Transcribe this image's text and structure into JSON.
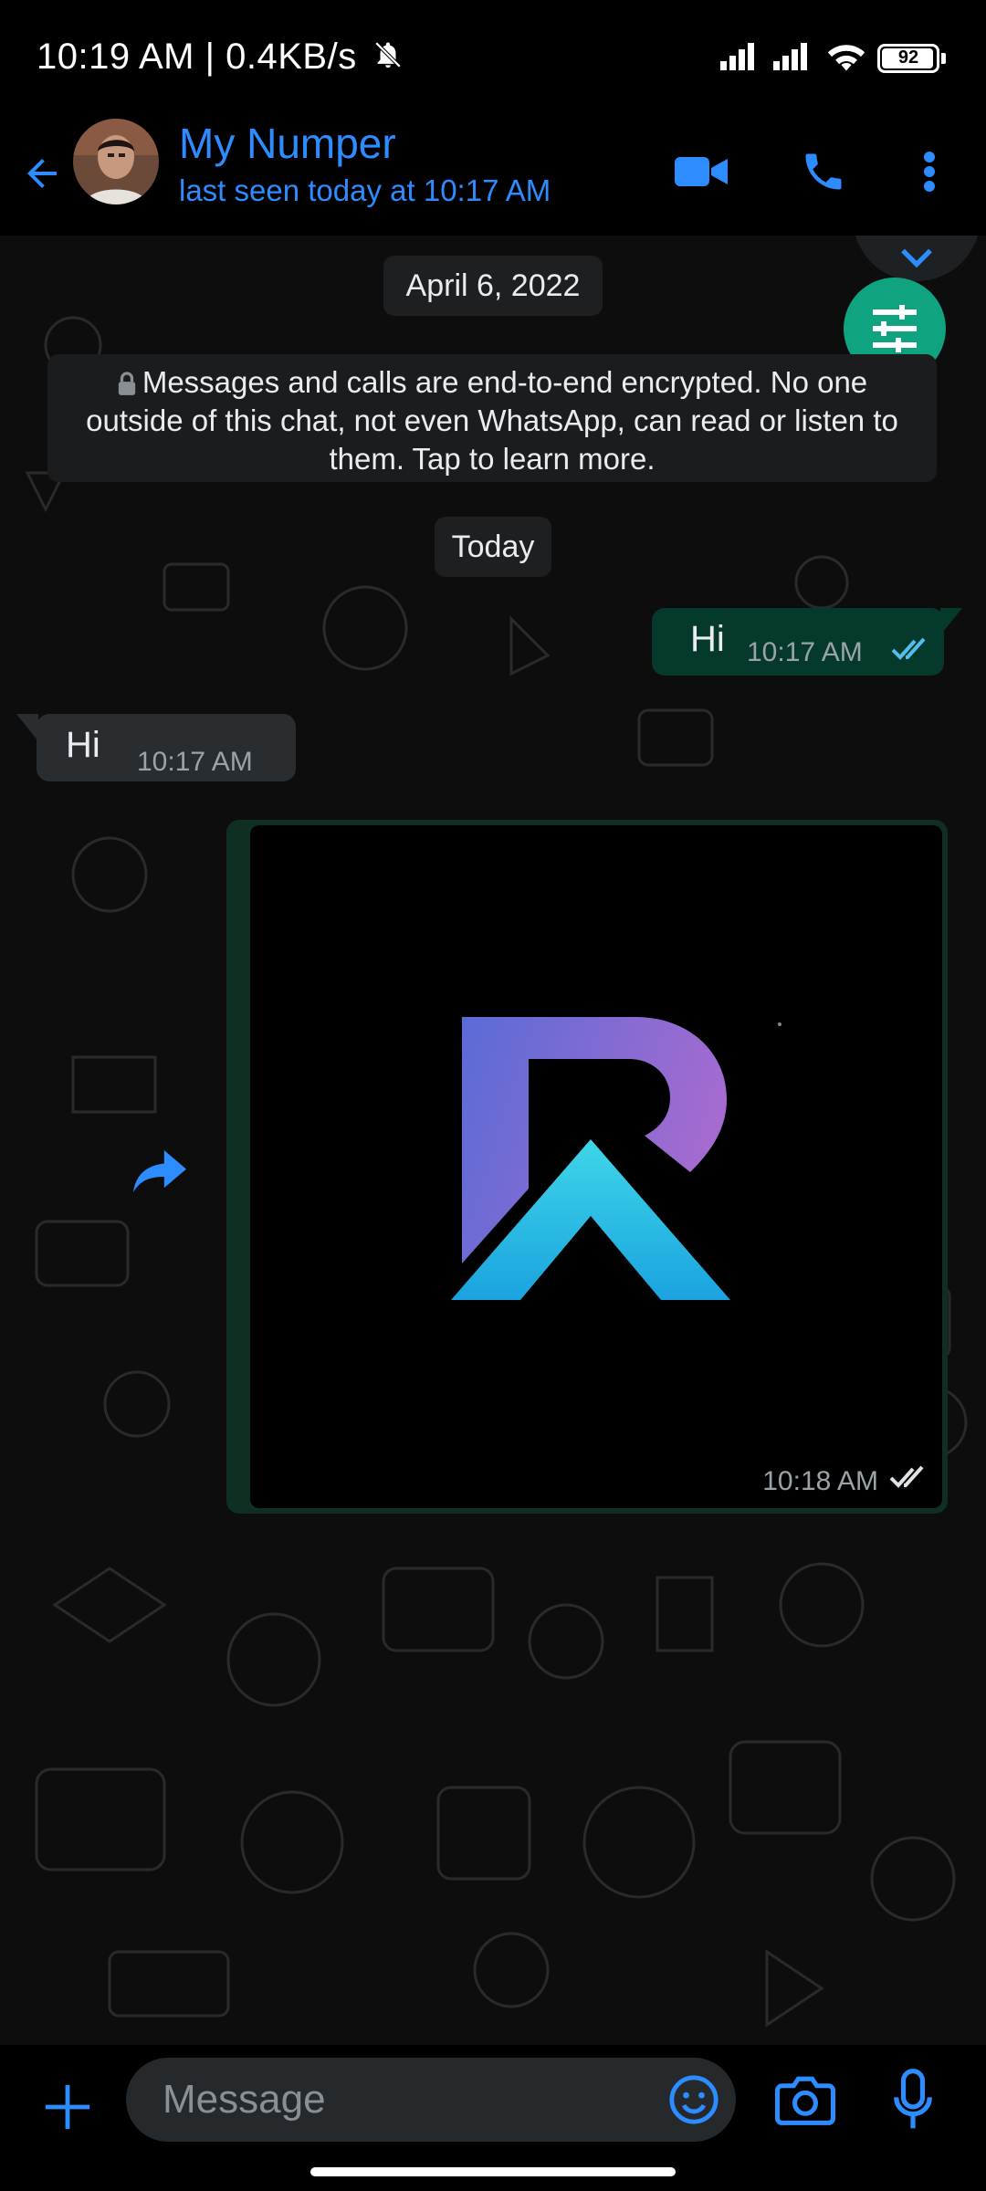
{
  "status_bar": {
    "time_text": "10:19 AM | 0.4KB/s",
    "battery_level": "92",
    "icons": [
      "bell-off-icon",
      "signal-icon",
      "signal-icon",
      "wifi-icon",
      "battery-icon"
    ]
  },
  "header": {
    "contact_name": "My Numper",
    "last_seen": "last seen today at 10:17 AM",
    "icons": [
      "back-arrow-icon",
      "video-call-icon",
      "voice-call-icon",
      "more-vert-icon"
    ]
  },
  "chat": {
    "date_chip": "April 6, 2022",
    "encryption_notice": "Messages and calls are end-to-end encrypted. No one outside of this chat, not even WhatsApp, can read or listen to them. Tap to learn more.",
    "today_chip": "Today",
    "messages": [
      {
        "direction": "outgoing",
        "text": "Hi",
        "time": "10:17 AM",
        "status": "read"
      },
      {
        "direction": "incoming",
        "text": "Hi",
        "time": "10:17 AM"
      },
      {
        "direction": "outgoing",
        "type": "image",
        "time": "10:18 AM",
        "status": "delivered"
      }
    ]
  },
  "composer": {
    "placeholder": "Message",
    "icons": [
      "plus-icon",
      "emoji-icon",
      "camera-icon",
      "mic-icon"
    ]
  },
  "colors": {
    "accent": "#2d8cff",
    "outgoing_bubble": "#05392c",
    "incoming_bubble": "#2a2d30",
    "fab": "#10a37f",
    "read_ticks": "#53bdeb"
  }
}
